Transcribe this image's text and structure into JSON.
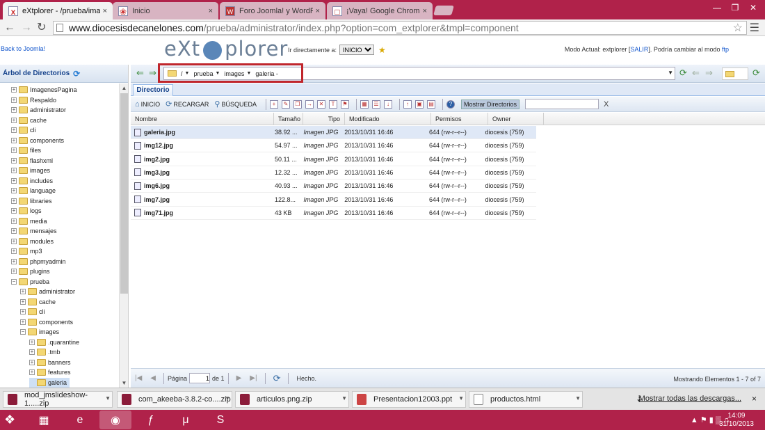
{
  "browser": {
    "tabs": [
      {
        "label": "eXtplorer - /prueba/imag…",
        "icon": "x",
        "close": "×"
      },
      {
        "label": "Inicio",
        "icon": "❀",
        "close": "×"
      },
      {
        "label": "Foro Joomla! y WordPress",
        "icon": "W",
        "close": "×"
      },
      {
        "label": "¡Vaya! Google Chrome no",
        "icon": "□",
        "close": "×"
      }
    ],
    "url_host": "www.diocesisdecanelones.com",
    "url_path": "/prueba/administrator/index.php?option=com_extplorer&tmpl=component"
  },
  "header": {
    "back_link": "Back to Joomla!",
    "logo_left": "eXt",
    "logo_right": "plorer",
    "jump_label": "Ir directamente a:",
    "jump_value": "INICIO",
    "mode_prefix": "Modo Actual: extplorer [",
    "mode_exit": "SALIR",
    "mode_middle": "]. Podría cambiar al modo ",
    "mode_ftp": "ftp"
  },
  "tree": {
    "title": "Árbol de Directorios",
    "nodes": [
      {
        "label": "ImagenesPagina",
        "level": 0,
        "exp": "+"
      },
      {
        "label": "Respaldo",
        "level": 0,
        "exp": "+"
      },
      {
        "label": "administrator",
        "level": 0,
        "exp": "+"
      },
      {
        "label": "cache",
        "level": 0,
        "exp": "+"
      },
      {
        "label": "cli",
        "level": 0,
        "exp": "+"
      },
      {
        "label": "components",
        "level": 0,
        "exp": "+"
      },
      {
        "label": "files",
        "level": 0,
        "exp": "+"
      },
      {
        "label": "flashxml",
        "level": 0,
        "exp": "+"
      },
      {
        "label": "images",
        "level": 0,
        "exp": "+"
      },
      {
        "label": "includes",
        "level": 0,
        "exp": "+"
      },
      {
        "label": "language",
        "level": 0,
        "exp": "+"
      },
      {
        "label": "libraries",
        "level": 0,
        "exp": "+"
      },
      {
        "label": "logs",
        "level": 0,
        "exp": "+"
      },
      {
        "label": "media",
        "level": 0,
        "exp": "+"
      },
      {
        "label": "mensajes",
        "level": 0,
        "exp": "+"
      },
      {
        "label": "modules",
        "level": 0,
        "exp": "+"
      },
      {
        "label": "mp3",
        "level": 0,
        "exp": "+"
      },
      {
        "label": "phpmyadmin",
        "level": 0,
        "exp": "+"
      },
      {
        "label": "plugins",
        "level": 0,
        "exp": "+"
      },
      {
        "label": "prueba",
        "level": 0,
        "exp": "−"
      },
      {
        "label": "administrator",
        "level": 1,
        "exp": "+"
      },
      {
        "label": "cache",
        "level": 1,
        "exp": "+"
      },
      {
        "label": "cli",
        "level": 1,
        "exp": "+"
      },
      {
        "label": "components",
        "level": 1,
        "exp": "+"
      },
      {
        "label": "images",
        "level": 1,
        "exp": "−"
      },
      {
        "label": ".quarantine",
        "level": 2,
        "exp": "+"
      },
      {
        "label": ".tmb",
        "level": 2,
        "exp": "+"
      },
      {
        "label": "banners",
        "level": 2,
        "exp": "+"
      },
      {
        "label": "features",
        "level": 2,
        "exp": "+"
      },
      {
        "label": "galeria",
        "level": 2,
        "exp": "",
        "selected": true
      }
    ]
  },
  "path": {
    "crumbs": [
      "/",
      "prueba",
      "images",
      "galeria -"
    ]
  },
  "main": {
    "tab_label": "Directorio",
    "toolbar": {
      "home": "INICIO",
      "reload": "RECARGAR",
      "search": "BÚSQUEDA",
      "show_dirs": "Mostrar Directorios",
      "clear": "X"
    },
    "columns": [
      "Nombre",
      "Tamaño",
      "Tipo",
      "Modificado",
      "Permisos",
      "Owner"
    ],
    "rows": [
      {
        "name": "galeria.jpg",
        "size": "38.92 ...",
        "type": "Imagen JPG",
        "modified": "2013/10/31 16:46",
        "perms": "644 (rw-r--r--)",
        "owner": "diocesis (759)",
        "selected": true
      },
      {
        "name": "img12.jpg",
        "size": "54.97 ...",
        "type": "Imagen JPG",
        "modified": "2013/10/31 16:46",
        "perms": "644 (rw-r--r--)",
        "owner": "diocesis (759)"
      },
      {
        "name": "img2.jpg",
        "size": "50.11 ...",
        "type": "Imagen JPG",
        "modified": "2013/10/31 16:46",
        "perms": "644 (rw-r--r--)",
        "owner": "diocesis (759)"
      },
      {
        "name": "img3.jpg",
        "size": "12.32 ...",
        "type": "Imagen JPG",
        "modified": "2013/10/31 16:46",
        "perms": "644 (rw-r--r--)",
        "owner": "diocesis (759)"
      },
      {
        "name": "img6.jpg",
        "size": "40.93 ...",
        "type": "Imagen JPG",
        "modified": "2013/10/31 16:46",
        "perms": "644 (rw-r--r--)",
        "owner": "diocesis (759)"
      },
      {
        "name": "img7.jpg",
        "size": "122.8...",
        "type": "Imagen JPG",
        "modified": "2013/10/31 16:46",
        "perms": "644 (rw-r--r--)",
        "owner": "diocesis (759)"
      },
      {
        "name": "img71.jpg",
        "size": "43 KB",
        "type": "Imagen JPG",
        "modified": "2013/10/31 16:46",
        "perms": "644 (rw-r--r--)",
        "owner": "diocesis (759)"
      }
    ],
    "pager": {
      "page_label": "Página",
      "page_value": "1",
      "of_label": "de 1",
      "done": "Hecho.",
      "status": "Mostrando Elementos 1 - 7 of 7"
    }
  },
  "downloads": {
    "items": [
      {
        "label": "mod_jmslideshow-1.....zip",
        "kind": "zip"
      },
      {
        "label": "com_akeeba-3.8.2-co....zip",
        "kind": "zip"
      },
      {
        "label": "articulos.png.zip",
        "kind": "zip"
      },
      {
        "label": "Presentacion12003.ppt",
        "kind": "ppt"
      },
      {
        "label": "productos.html",
        "kind": "doc"
      }
    ],
    "show_all": "Mostrar todas las descargas...",
    "close": "×"
  },
  "taskbar": {
    "time": "14:09",
    "date": "31/10/2013"
  },
  "colors": {
    "chrome_frame": "#b0224a",
    "highlight_box": "#c0262c",
    "ext_header": "#15428b"
  }
}
